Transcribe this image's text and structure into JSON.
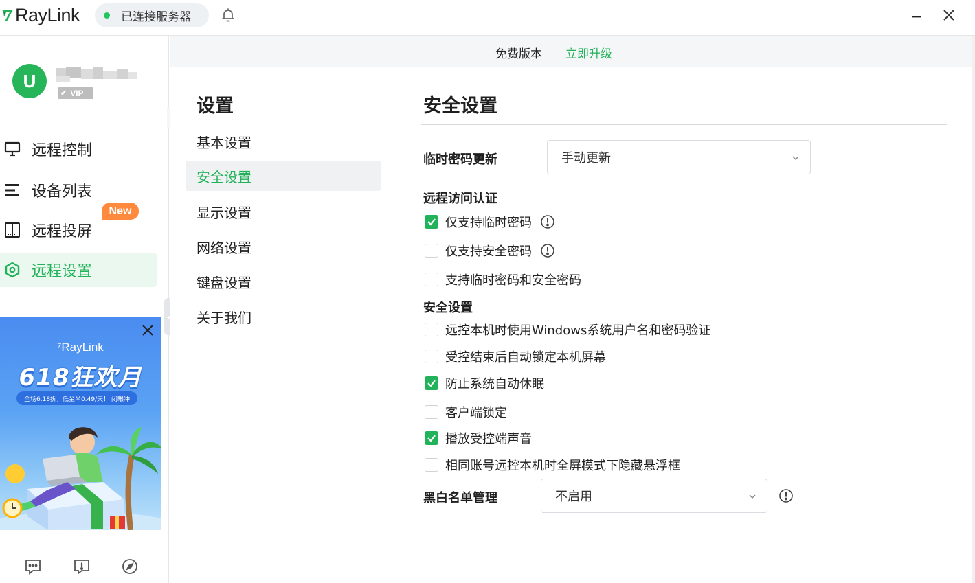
{
  "app": {
    "brand": "RayLink",
    "connection_status": "已连接服务器",
    "accent_color": "#22b35a"
  },
  "user": {
    "avatar_letter": "U",
    "vip_label": "VIP"
  },
  "sidebar": {
    "items": [
      {
        "label": "远程控制",
        "icon": "monitor-icon"
      },
      {
        "label": "设备列表",
        "icon": "list-icon"
      },
      {
        "label": "远程投屏",
        "icon": "cast-screen-icon"
      },
      {
        "label": "远程设置",
        "icon": "settings-hex-icon"
      }
    ],
    "new_badge": "New",
    "active_index": 3
  },
  "ad": {
    "brand": "RayLink",
    "title": "618狂欢月",
    "subtitle": "全场6.18折，低至￥0.49/天！ 闭眼冲"
  },
  "upgrade": {
    "free_label": "免费版本",
    "upgrade_link": "立即升级"
  },
  "settings_nav": {
    "title": "设置",
    "items": [
      "基本设置",
      "安全设置",
      "显示设置",
      "网络设置",
      "键盘设置",
      "关于我们"
    ],
    "active_index": 1
  },
  "content": {
    "title": "安全设置",
    "temp_password": {
      "label": "临时密码更新",
      "value": "手动更新"
    },
    "remote_auth": {
      "label": "远程访问认证",
      "options": [
        {
          "label": "仅支持临时密码",
          "checked": true
        },
        {
          "label": "仅支持安全密码",
          "checked": false
        },
        {
          "label": "支持临时密码和安全密码",
          "checked": false
        }
      ]
    },
    "security": {
      "label": "安全设置",
      "options": [
        {
          "label": "远控本机时使用Windows系统用户名和密码验证",
          "checked": false
        },
        {
          "label": "受控结束后自动锁定本机屏幕",
          "checked": false
        },
        {
          "label": "防止系统自动休眠",
          "checked": true
        },
        {
          "label": "客户端锁定",
          "checked": false
        },
        {
          "label": "播放受控端声音",
          "checked": true
        },
        {
          "label": "相同账号远控本机时全屏模式下隐藏悬浮框",
          "checked": false
        }
      ]
    },
    "blacklist": {
      "label": "黑白名单管理",
      "value": "不启用"
    }
  }
}
